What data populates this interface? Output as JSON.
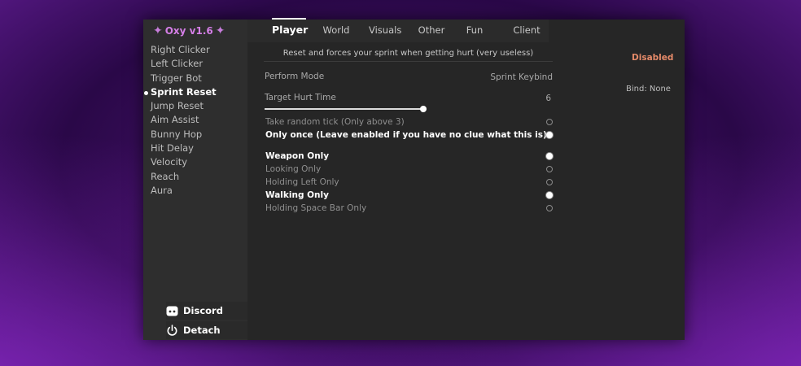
{
  "app": {
    "title": "Oxy v1.6"
  },
  "sidebar": {
    "items": [
      {
        "label": "Right Clicker",
        "active": false
      },
      {
        "label": "Left Clicker",
        "active": false
      },
      {
        "label": "Trigger Bot",
        "active": false
      },
      {
        "label": "Sprint Reset",
        "active": true
      },
      {
        "label": "Jump Reset",
        "active": false
      },
      {
        "label": "Aim Assist",
        "active": false
      },
      {
        "label": "Bunny Hop",
        "active": false
      },
      {
        "label": "Hit Delay",
        "active": false
      },
      {
        "label": "Velocity",
        "active": false
      },
      {
        "label": "Reach",
        "active": false
      },
      {
        "label": "Aura",
        "active": false
      }
    ],
    "discord_label": "Discord",
    "detach_label": "Detach"
  },
  "tabs": [
    {
      "label": "Player",
      "active": true
    },
    {
      "label": "World",
      "active": false
    },
    {
      "label": "Visuals",
      "active": false
    },
    {
      "label": "Other",
      "active": false
    },
    {
      "label": "Fun",
      "active": false
    },
    {
      "label": "Client",
      "active": false
    }
  ],
  "module": {
    "description": "Reset and forces your sprint when getting hurt (very useless)",
    "perform_mode": {
      "label": "Perform Mode",
      "value": "Sprint Keybind"
    },
    "target_hurt_time": {
      "label": "Target Hurt Time",
      "value": "6",
      "fraction": 0.55
    },
    "tick_options": [
      {
        "label": "Take random tick (Only above 3)",
        "selected": false
      },
      {
        "label": "Only once (Leave enabled if you have no clue what this is)",
        "selected": true
      }
    ],
    "conditions": [
      {
        "label": "Weapon Only",
        "selected": true
      },
      {
        "label": "Looking Only",
        "selected": false
      },
      {
        "label": "Holding Left Only",
        "selected": false
      },
      {
        "label": "Walking Only",
        "selected": true
      },
      {
        "label": "Holding Space Bar Only",
        "selected": false
      }
    ]
  },
  "status": {
    "label": "Disabled",
    "color": "#e58a69"
  },
  "bind": {
    "label": "Bind: None"
  },
  "colors": {
    "accent": "#d47ee6",
    "background": "#262626",
    "sidebar": "#2e2e2e"
  }
}
